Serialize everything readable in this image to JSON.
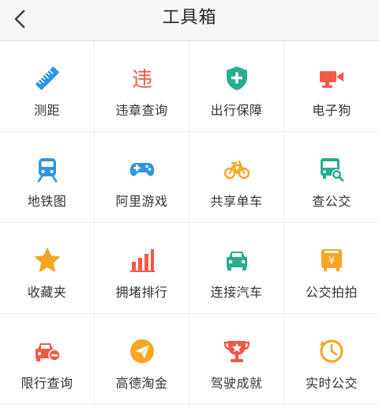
{
  "header": {
    "title": "工具箱",
    "back_icon": "chevron-left-icon"
  },
  "colors": {
    "blue": "#2f95e0",
    "red": "#ef5a45",
    "green": "#28ad8e",
    "orange": "#f5a623"
  },
  "tools": [
    {
      "label": "测距",
      "icon": "ruler-icon",
      "icon_text": "",
      "color": "#2f95e0"
    },
    {
      "label": "违章查询",
      "icon": "violation-icon",
      "icon_text": "违",
      "color": "#ef5a45"
    },
    {
      "label": "出行保障",
      "icon": "shield-plus-icon",
      "icon_text": "",
      "color": "#28ad8e"
    },
    {
      "label": "电子狗",
      "icon": "camera-icon",
      "icon_text": "",
      "color": "#ef5a45"
    },
    {
      "label": "地铁图",
      "icon": "subway-icon",
      "icon_text": "",
      "color": "#2f95e0"
    },
    {
      "label": "阿里游戏",
      "icon": "gamepad-icon",
      "icon_text": "",
      "color": "#2f95e0"
    },
    {
      "label": "共享单车",
      "icon": "bicycle-icon",
      "icon_text": "",
      "color": "#f5a623"
    },
    {
      "label": "查公交",
      "icon": "bus-search-icon",
      "icon_text": "",
      "color": "#28ad8e"
    },
    {
      "label": "收藏夹",
      "icon": "star-icon",
      "icon_text": "",
      "color": "#f5a623"
    },
    {
      "label": "拥堵排行",
      "icon": "bar-chart-icon",
      "icon_text": "",
      "color": "#ef5a45"
    },
    {
      "label": "连接汽车",
      "icon": "car-icon",
      "icon_text": "",
      "color": "#28ad8e"
    },
    {
      "label": "公交拍拍",
      "icon": "bus-yuan-icon",
      "icon_text": "¥",
      "color": "#f5a623"
    },
    {
      "label": "限行查询",
      "icon": "car-restrict-icon",
      "icon_text": "",
      "color": "#ef5a45"
    },
    {
      "label": "高德淘金",
      "icon": "paper-plane-icon",
      "icon_text": "",
      "color": "#f5a623"
    },
    {
      "label": "驾驶成就",
      "icon": "trophy-icon",
      "icon_text": "",
      "color": "#ef5a45"
    },
    {
      "label": "实时公交",
      "icon": "clock-icon",
      "icon_text": "",
      "color": "#f5a623"
    }
  ]
}
